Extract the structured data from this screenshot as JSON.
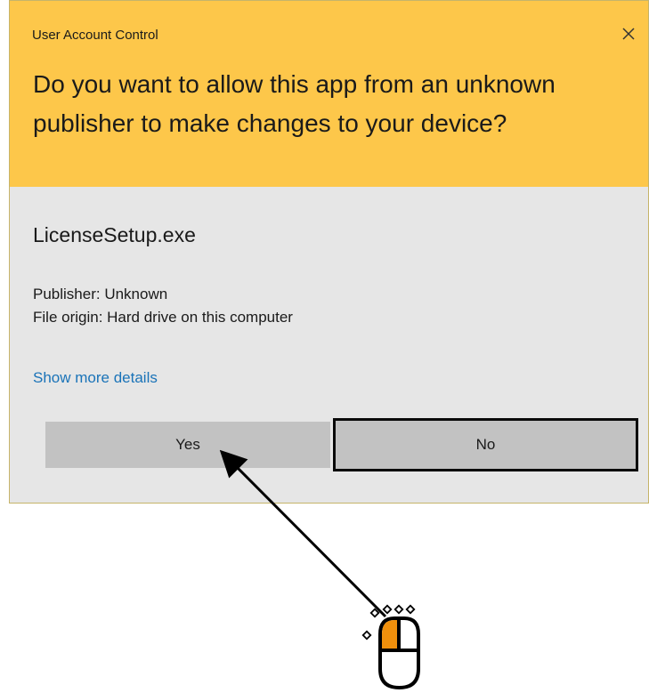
{
  "dialog": {
    "title": "User Account Control",
    "question": "Do you want to allow this app from an unknown publisher to make changes to your device?",
    "app_name": "LicenseSetup.exe",
    "publisher_line": "Publisher: Unknown",
    "origin_line": "File origin: Hard drive on this computer",
    "more_details_label": "Show more details",
    "yes_label": "Yes",
    "no_label": "No",
    "close_icon": "close-icon"
  },
  "annotation": {
    "pointer": "arrow-icon",
    "mouse": "mouse-left-click-icon",
    "highlight_color": "#f0900c"
  },
  "colors": {
    "header": "#fdc74a",
    "body": "#e6e6e6",
    "button": "#c2c2c2",
    "link": "#1a73b8"
  }
}
